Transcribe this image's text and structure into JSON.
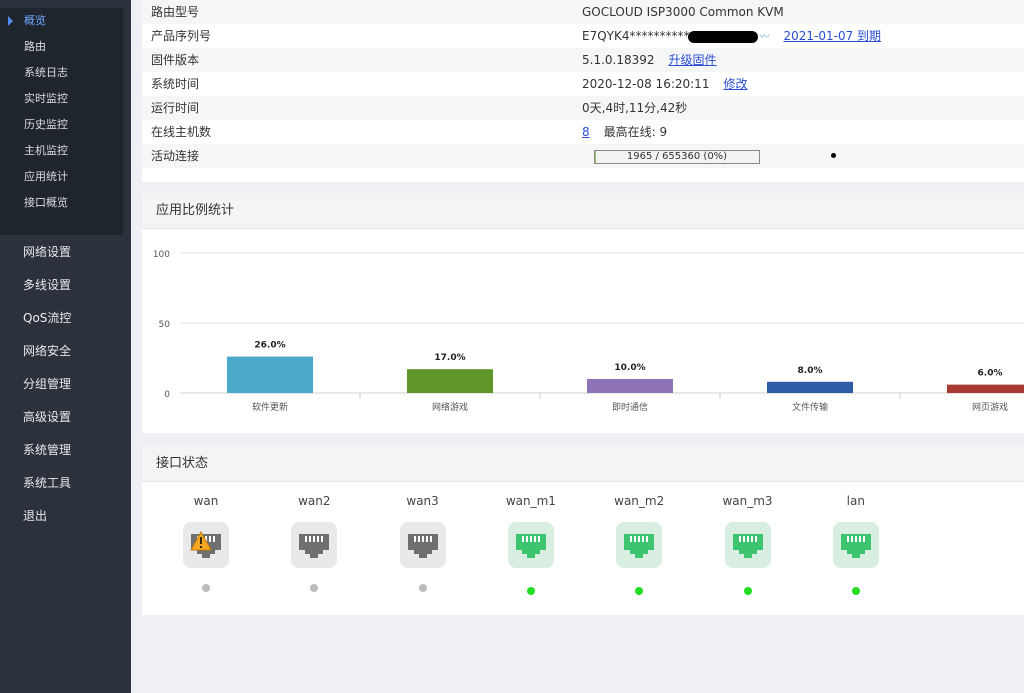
{
  "sidebar": {
    "sub_items": [
      {
        "label": "概览",
        "active": true
      },
      {
        "label": "路由"
      },
      {
        "label": "系统日志"
      },
      {
        "label": "实时监控"
      },
      {
        "label": "历史监控"
      },
      {
        "label": "主机监控"
      },
      {
        "label": "应用统计"
      },
      {
        "label": "接口概览"
      }
    ],
    "main_items": [
      {
        "label": "网络设置"
      },
      {
        "label": "多线设置"
      },
      {
        "label": "QoS流控"
      },
      {
        "label": "网络安全"
      },
      {
        "label": "分组管理"
      },
      {
        "label": "高级设置"
      },
      {
        "label": "系统管理"
      },
      {
        "label": "系统工具"
      },
      {
        "label": "退出"
      }
    ]
  },
  "info": {
    "model_label": "路由型号",
    "model_value": "GOCLOUD ISP3000 Common KVM",
    "serial_label": "产品序列号",
    "serial_value": "E7QYK4**********",
    "serial_expire": "2021-01-07 到期",
    "firmware_label": "固件版本",
    "firmware_value": "5.1.0.18392",
    "firmware_upgrade": "升级固件",
    "time_label": "系统时间",
    "time_value": "2020-12-08 16:20:11",
    "time_modify": "修改",
    "uptime_label": "运行时间",
    "uptime_value": "0天,4时,11分,42秒",
    "hosts_label": "在线主机数",
    "hosts_value": "8",
    "hosts_max_label": "最高在线:",
    "hosts_max_value": "9",
    "conn_label": "活动连接",
    "conn_value": "1965 / 655360 (0%)",
    "conn_fraction": 0.003
  },
  "chart_panel": {
    "title": "应用比例统计"
  },
  "chart_data": {
    "type": "bar",
    "categories": [
      "软件更新",
      "网络游戏",
      "即时通信",
      "文件传输",
      "网页游戏"
    ],
    "values": [
      26.0,
      17.0,
      10.0,
      8.0,
      6.0
    ],
    "value_labels": [
      "26.0%",
      "17.0%",
      "10.0%",
      "8.0%",
      "6.0%"
    ],
    "colors": [
      "#4aa8c8",
      "#5f962a",
      "#8f73b8",
      "#2f5ea8",
      "#a83a32"
    ],
    "yticks": [
      0,
      50,
      100
    ],
    "ylim": [
      0,
      100
    ],
    "grid": true
  },
  "iface_panel": {
    "title": "接口状态",
    "interfaces": [
      {
        "name": "wan",
        "up": false,
        "warning": true
      },
      {
        "name": "wan2",
        "up": false,
        "warning": false
      },
      {
        "name": "wan3",
        "up": false,
        "warning": false
      },
      {
        "name": "wan_m1",
        "up": true,
        "warning": false
      },
      {
        "name": "wan_m2",
        "up": true,
        "warning": false
      },
      {
        "name": "wan_m3",
        "up": true,
        "warning": false
      },
      {
        "name": "lan",
        "up": true,
        "warning": false
      }
    ]
  },
  "colors": {
    "sidebar_bg": "#2b323c",
    "submenu_bg": "#1f252d",
    "active_text": "#6fa6ff",
    "port_on": "#3cc46e",
    "port_off": "#6d6f70",
    "dot_on": "#22dd22",
    "dot_off": "#b9bdbf",
    "warning": "#f5a623"
  }
}
